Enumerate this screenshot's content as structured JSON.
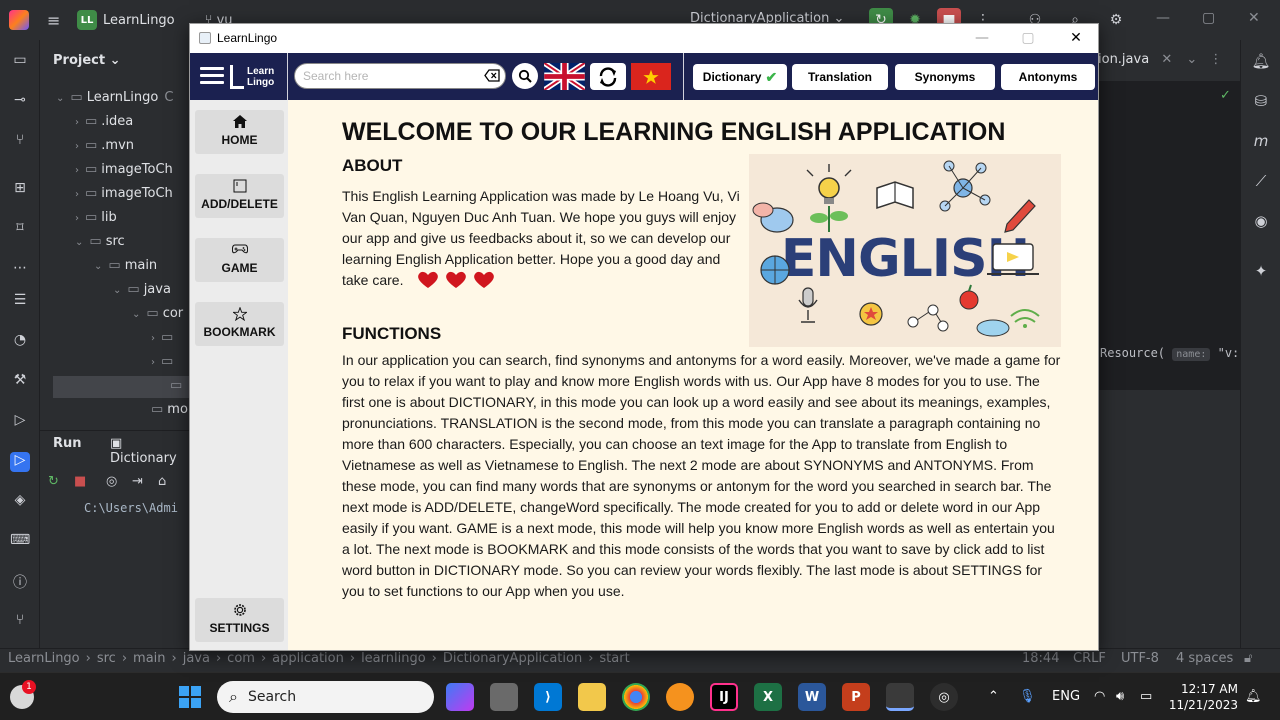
{
  "ide": {
    "project_badge": "LL",
    "project_name": "LearnLingo",
    "vcs": "vu",
    "run_config": "DictionaryApplication",
    "project_panel_title": "Project",
    "tree": [
      {
        "label": "LearnLingo",
        "suffix": "C",
        "indent": 0,
        "arrow": "open"
      },
      {
        "label": ".idea",
        "indent": 1,
        "arrow": "closed"
      },
      {
        "label": ".mvn",
        "indent": 1,
        "arrow": "closed"
      },
      {
        "label": "imageToCh",
        "indent": 1,
        "arrow": "closed"
      },
      {
        "label": "imageToCh",
        "indent": 1,
        "arrow": "closed"
      },
      {
        "label": "lib",
        "indent": 1,
        "arrow": "closed"
      },
      {
        "label": "src",
        "indent": 1,
        "arrow": "open"
      },
      {
        "label": "main",
        "indent": 2,
        "arrow": "open"
      },
      {
        "label": "java",
        "indent": 3,
        "arrow": "open"
      },
      {
        "label": "cor",
        "indent": 4,
        "arrow": "open"
      },
      {
        "label": "",
        "indent": 5,
        "arrow": "closed"
      },
      {
        "label": "",
        "indent": 5,
        "arrow": "closed"
      },
      {
        "label": "",
        "indent": 6,
        "arrow": "none"
      },
      {
        "label": "mo",
        "indent": 5,
        "arrow": "none"
      }
    ],
    "run_title": "Run",
    "run_tab": "Dictionary",
    "console_line": "C:\\Users\\Admi",
    "editor_tab": "ion.java",
    "code_line": "Resource(",
    "code_hint": "name:",
    "code_tail": "\"v:",
    "status_crumbs": [
      "LearnLingo",
      "src",
      "main",
      "java",
      "com",
      "application",
      "learnlingo",
      "DictionaryApplication",
      "start"
    ],
    "status_right": {
      "position": "18:44",
      "line_sep": "CRLF",
      "encoding": "UTF-8",
      "indent": "4 spaces"
    }
  },
  "taskbar": {
    "search_label": "Search",
    "language": "ENG",
    "time": "12:17 AM",
    "date": "11/21/2023",
    "notification_count": "1"
  },
  "app": {
    "window_title": "LearnLingo",
    "brand_line1": "Learn",
    "brand_line2": "Lingo",
    "search_placeholder": "Search here",
    "tabs": [
      {
        "label": "Dictionary",
        "active": true
      },
      {
        "label": "Translation",
        "active": false
      },
      {
        "label": "Synonyms",
        "active": false
      },
      {
        "label": "Antonyms",
        "active": false
      }
    ],
    "sidebar": [
      {
        "label": "HOME",
        "icon": "home-icon"
      },
      {
        "label": "ADD/DELETE",
        "icon": "edit-icon"
      },
      {
        "label": "GAME",
        "icon": "gamepad-icon"
      },
      {
        "label": "BOOKMARK",
        "icon": "star-icon"
      },
      {
        "label": "SETTINGS",
        "icon": "gear-icon"
      }
    ],
    "welcome": "WELCOME TO OUR LEARNING ENGLISH APPLICATION",
    "about_title": "ABOUT",
    "about_text": "This English Learning Application was made by Le Hoang Vu, Vi Van Quan, Nguyen Duc Anh Tuan. We hope you guys will enjoy our app and give us feedbacks about it, so we can develop our learning English Application better. Hope you a good day and take care.",
    "functions_title": "FUNCTIONS",
    "functions_text": "In our application you can search, find synonyms and antonyms for a word easily. Moreover, we've made a game for you to relax if you want to play and know more English words with us. Our App have 8 modes for you to use. The first one is about DICTIONARY, in this mode you can look up a word easily and see about its meanings, examples, pronunciations. TRANSLATION is the second mode, from this mode you can translate a paragraph containing no more than 600 characters. Especially, you can choose an text image for the App to translate from English to Vietnamese as well as Vietnamese to English. The next 2 mode are about SYNONYMS and ANTONYMS. From these mode, you can find many words that are synonyms or antonym for the word you searched in search bar. The next mode is ADD/DELETE, changeWord specifically. The mode created for you to add or delete word in our App easily if you want. GAME is a next mode, this mode will help you know more English words as well as entertain you a lot. The next mode is BOOKMARK and this mode consists of the words that you want to save by click add to list word button in DICTIONARY mode. So you can review your words flexibly. The last mode is about SETTINGS for you to set functions to our App when you use.",
    "image_word": "ENGLISH",
    "colors": {
      "topbar": "#1b2150",
      "content_bg": "#fff8e7",
      "sidebar_bg": "#ececec",
      "heart": "#d0161e"
    }
  }
}
